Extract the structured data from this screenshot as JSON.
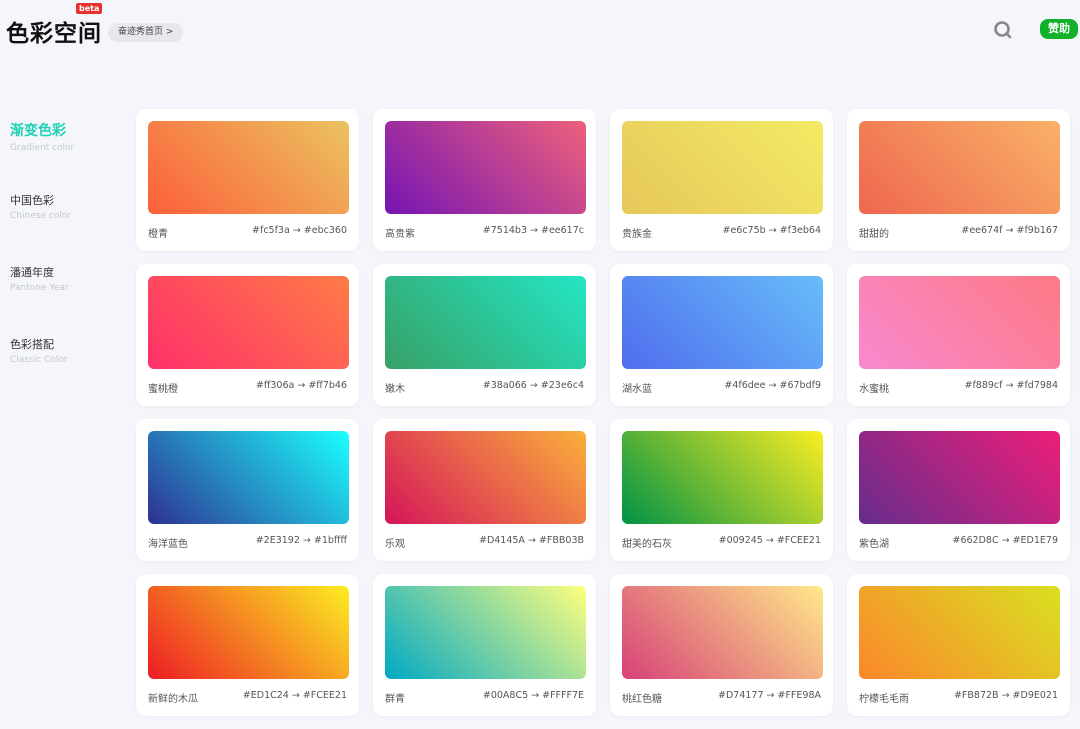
{
  "header": {
    "logo": "色彩空间",
    "beta_badge": "beta",
    "home_link": "奋迹秀首页 >",
    "search_icon": "search-icon",
    "donate_label": "赞助",
    "donate_color": "#12b12a"
  },
  "sidebar": {
    "items": [
      {
        "cn": "渐变色彩",
        "en": "Gradient color",
        "active": true
      },
      {
        "cn": "中国色彩",
        "en": "Chinese color",
        "active": false
      },
      {
        "cn": "潘通年度",
        "en": "Pantone Year",
        "active": false
      },
      {
        "cn": "色彩搭配",
        "en": "Classic Color",
        "active": false
      }
    ],
    "accent_color": "#1fd1b5"
  },
  "gradients": [
    {
      "name": "橙青",
      "from": "#fc5f3a",
      "to": "#ebc360",
      "codes": "#fc5f3a → #ebc360"
    },
    {
      "name": "高贵紫",
      "from": "#7514b3",
      "to": "#ee617c",
      "codes": "#7514b3 → #ee617c"
    },
    {
      "name": "贵族金",
      "from": "#e6c75b",
      "to": "#f3eb64",
      "codes": "#e6c75b → #f3eb64"
    },
    {
      "name": "甜甜的",
      "from": "#ee674f",
      "to": "#f9b167",
      "codes": "#ee674f → #f9b167"
    },
    {
      "name": "蜜桃橙",
      "from": "#ff306a",
      "to": "#ff7b46",
      "codes": "#ff306a → #ff7b46"
    },
    {
      "name": "嫩木",
      "from": "#38a066",
      "to": "#23e6c4",
      "codes": "#38a066 → #23e6c4"
    },
    {
      "name": "湖水蓝",
      "from": "#4f6dee",
      "to": "#67bdf9",
      "codes": "#4f6dee → #67bdf9"
    },
    {
      "name": "水蜜桃",
      "from": "#f889cf",
      "to": "#fd7984",
      "codes": "#f889cf → #fd7984"
    },
    {
      "name": "海洋蓝色",
      "from": "#2E3192",
      "to": "#1bffff",
      "codes": "#2E3192 → #1bffff"
    },
    {
      "name": "乐观",
      "from": "#D4145A",
      "to": "#FBB03B",
      "codes": "#D4145A → #FBB03B"
    },
    {
      "name": "甜美的石灰",
      "from": "#009245",
      "to": "#FCEE21",
      "codes": "#009245 → #FCEE21"
    },
    {
      "name": "紫色湖",
      "from": "#662D8C",
      "to": "#ED1E79",
      "codes": "#662D8C → #ED1E79"
    },
    {
      "name": "新鲜的木瓜",
      "from": "#ED1C24",
      "to": "#FCEE21",
      "codes": "#ED1C24 → #FCEE21"
    },
    {
      "name": "群青",
      "from": "#00A8C5",
      "to": "#FFFF7E",
      "codes": "#00A8C5 → #FFFF7E"
    },
    {
      "name": "桃红色糖",
      "from": "#D74177",
      "to": "#FFE98A",
      "codes": "#D74177 → #FFE98A"
    },
    {
      "name": "柠檬毛毛雨",
      "from": "#FB872B",
      "to": "#D9E021",
      "codes": "#FB872B → #D9E021"
    }
  ]
}
